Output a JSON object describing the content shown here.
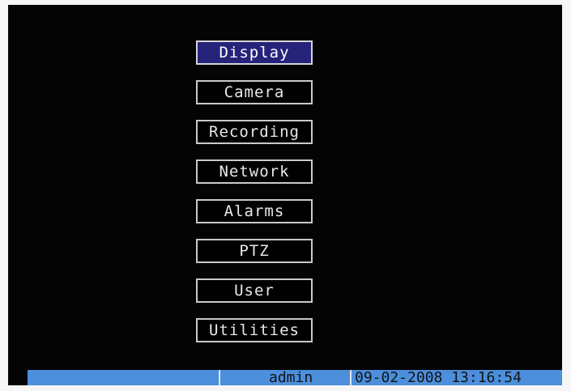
{
  "menu": {
    "items": [
      {
        "label": "Display",
        "selected": true
      },
      {
        "label": "Camera"
      },
      {
        "label": "Recording"
      },
      {
        "label": "Network"
      },
      {
        "label": "Alarms"
      },
      {
        "label": "PTZ"
      },
      {
        "label": "User"
      },
      {
        "label": "Utilities"
      }
    ]
  },
  "status_bar": {
    "user": "admin",
    "datetime": "09-02-2008 13:16:54"
  },
  "colors": {
    "background": "#040404",
    "selected_item": "#25237a",
    "status_bar": "#4b8fdd"
  }
}
